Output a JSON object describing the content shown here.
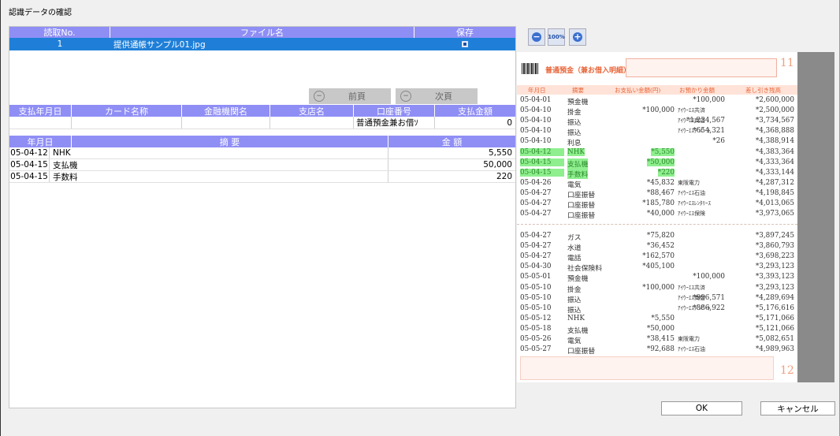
{
  "window": {
    "title": "認識データの確認"
  },
  "files_table": {
    "headers": {
      "no": "読取No.",
      "file": "ファイル名",
      "save": "保存"
    },
    "rows": [
      {
        "no": "1",
        "file": "提供通帳サンプル01.jpg",
        "saved": true
      }
    ]
  },
  "nav": {
    "prev_label": "前頁",
    "next_label": "次頁"
  },
  "payment_table": {
    "headers": {
      "date": "支払年月日",
      "card": "カード名称",
      "bank": "金融機関名",
      "branch": "支店名",
      "account": "口座番号",
      "amount": "支払金額"
    },
    "row": {
      "date": "",
      "card": "",
      "bank": "",
      "branch": "",
      "account": "普通預金兼お借ｿ",
      "amount": "0"
    }
  },
  "detail_table": {
    "headers": {
      "date": "年月日",
      "desc": "摘 要",
      "amount": "金 額"
    },
    "rows": [
      {
        "date": "05-04-12",
        "desc": "NHK",
        "amount": "5,550"
      },
      {
        "date": "05-04-15",
        "desc": "支払機",
        "amount": "50,000"
      },
      {
        "date": "05-04-15",
        "desc": "手数料",
        "amount": "220"
      }
    ]
  },
  "zoom": {
    "out_icon": "zoom-out-icon",
    "reset_label": "100%",
    "in_icon": "zoom-in-icon"
  },
  "passbook": {
    "title": "普通預金（兼お借入明細）",
    "page_top": "11",
    "page_bottom": "12",
    "col_headers": {
      "date": "年月日",
      "desc": "摘要",
      "withdraw": "お支払い金額(円)",
      "deposit": "お預かり金額",
      "balance": "差し引き残高"
    },
    "top_rows": [
      {
        "date": "05-04-01",
        "desc": "預金機",
        "withdraw": "",
        "counter": "",
        "deposit": "*100,000",
        "balance": "*2,600,000"
      },
      {
        "date": "05-04-10",
        "desc": "掛金",
        "withdraw": "*100,000",
        "counter": "ｱｲｳｰｴｽ共済",
        "deposit": "",
        "balance": "*2,500,000"
      },
      {
        "date": "05-04-10",
        "desc": "振込",
        "withdraw": "",
        "counter": "ｱｲｳｰｴｽ商店",
        "deposit": "*1,234,567",
        "balance": "*3,734,567"
      },
      {
        "date": "05-04-10",
        "desc": "振込",
        "withdraw": "",
        "counter": "ｱｲｳｰｴｽﾃﾞﾊﾟｰﾄ",
        "deposit": "*654,321",
        "balance": "*4,368,888"
      },
      {
        "date": "05-04-10",
        "desc": "利息",
        "withdraw": "",
        "counter": "",
        "deposit": "*26",
        "balance": "*4,388,914"
      },
      {
        "date": "05-04-12",
        "desc": "NHK",
        "withdraw": "*5,550",
        "counter": "",
        "deposit": "",
        "balance": "*4,383,364",
        "hl": true
      },
      {
        "date": "05-04-15",
        "desc": "支払機",
        "withdraw": "*50,000",
        "counter": "",
        "deposit": "",
        "balance": "*4,333,364",
        "hl": true
      },
      {
        "date": "05-04-15",
        "desc": "手数料",
        "withdraw": "*220",
        "counter": "",
        "deposit": "",
        "balance": "*4,333,144",
        "hl": true
      },
      {
        "date": "05-04-26",
        "desc": "電気",
        "withdraw": "*45,832",
        "counter": "東阪電力",
        "deposit": "",
        "balance": "*4,287,312"
      },
      {
        "date": "05-04-27",
        "desc": "口座振替",
        "withdraw": "*88,467",
        "counter": "ｱｲｳｰｴｽ石油",
        "deposit": "",
        "balance": "*4,198,845"
      },
      {
        "date": "05-04-27",
        "desc": "口座振替",
        "withdraw": "*185,780",
        "counter": "ｱｲｳｰｴｽﾚﾝﾀﾘｰｽ",
        "deposit": "",
        "balance": "*4,013,065"
      },
      {
        "date": "05-04-27",
        "desc": "口座振替",
        "withdraw": "*40,000",
        "counter": "ｱｲｳｰｴｽ保険",
        "deposit": "",
        "balance": "*3,973,065"
      }
    ],
    "bottom_rows": [
      {
        "date": "05-04-27",
        "desc": "ガス",
        "withdraw": "*75,820",
        "counter": "",
        "deposit": "",
        "balance": "*3,897,245"
      },
      {
        "date": "05-04-27",
        "desc": "水道",
        "withdraw": "*36,452",
        "counter": "",
        "deposit": "",
        "balance": "*3,860,793"
      },
      {
        "date": "05-04-27",
        "desc": "電話",
        "withdraw": "*162,570",
        "counter": "",
        "deposit": "",
        "balance": "*3,698,223"
      },
      {
        "date": "05-04-30",
        "desc": "社会保険料",
        "withdraw": "*405,100",
        "counter": "",
        "deposit": "",
        "balance": "*3,293,123"
      },
      {
        "date": "05-05-01",
        "desc": "預金機",
        "withdraw": "",
        "counter": "",
        "deposit": "*100,000",
        "balance": "*3,393,123"
      },
      {
        "date": "05-05-10",
        "desc": "掛金",
        "withdraw": "*100,000",
        "counter": "ｱｲｳｰｴｽ共済",
        "deposit": "",
        "balance": "*3,293,123"
      },
      {
        "date": "05-05-10",
        "desc": "振込",
        "withdraw": "",
        "counter": "ｱｲｳｰｴｽ商店",
        "deposit": "*996,571",
        "balance": "*4,289,694"
      },
      {
        "date": "05-05-10",
        "desc": "振込",
        "withdraw": "",
        "counter": "ｱｲｳｰｴｽﾃﾞﾊﾟｰﾄ",
        "deposit": "*886,922",
        "balance": "*5,176,616"
      },
      {
        "date": "05-05-12",
        "desc": "NHK",
        "withdraw": "*5,550",
        "counter": "",
        "deposit": "",
        "balance": "*5,171,066"
      },
      {
        "date": "05-05-18",
        "desc": "支払機",
        "withdraw": "*50,000",
        "counter": "",
        "deposit": "",
        "balance": "*5,121,066"
      },
      {
        "date": "05-05-26",
        "desc": "電気",
        "withdraw": "*38,415",
        "counter": "東阪電力",
        "deposit": "",
        "balance": "*5,082,651"
      },
      {
        "date": "05-05-27",
        "desc": "口座振替",
        "withdraw": "*92,688",
        "counter": "ｱｲｳｰｴｽ石油",
        "deposit": "",
        "balance": "*4,989,963"
      }
    ]
  },
  "buttons": {
    "ok": "OK",
    "cancel": "キャンセル"
  },
  "colors": {
    "header": "#8f8ef5",
    "selected_row": "#1f7fd8",
    "highlight": "#8fef8f",
    "passbook_accent": "#e8663a"
  }
}
